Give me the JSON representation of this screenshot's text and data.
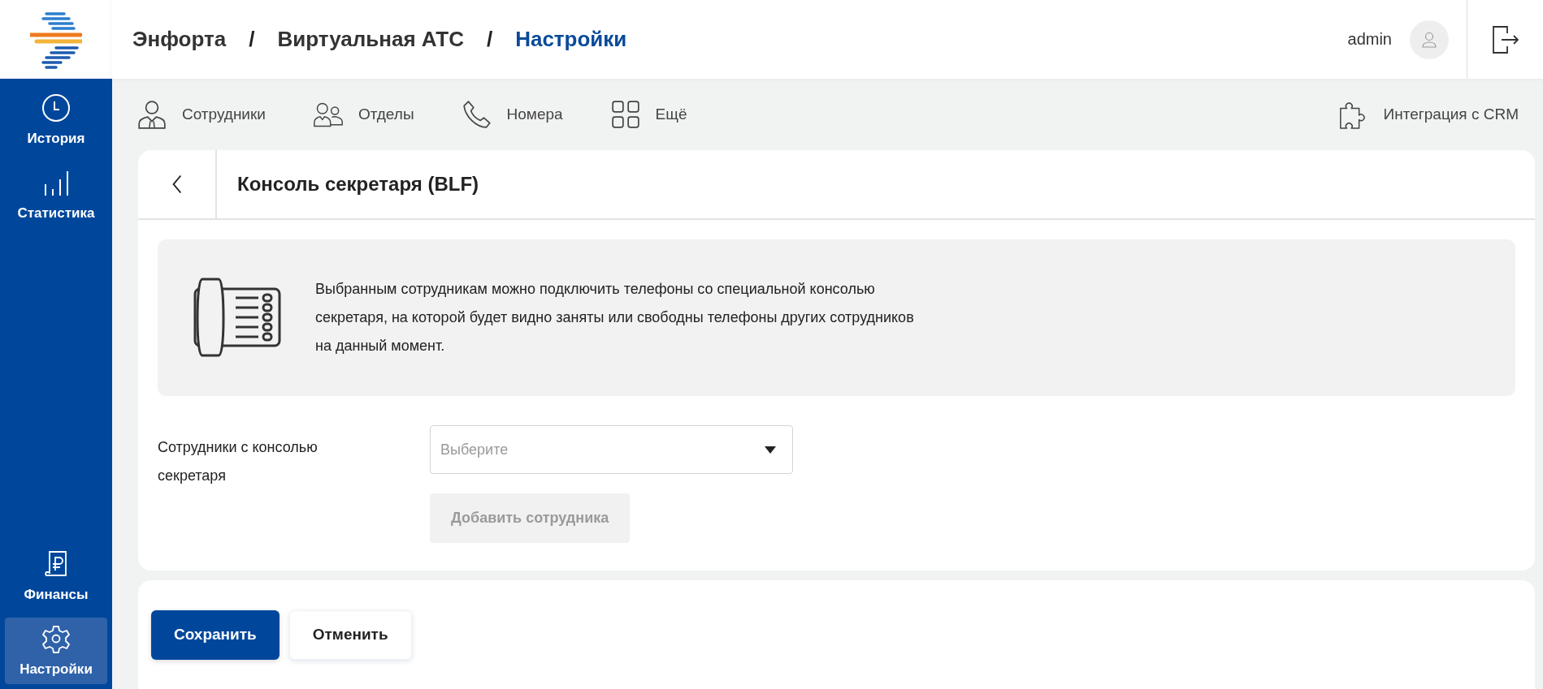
{
  "breadcrumbs": [
    {
      "label": "Энфорта",
      "current": false
    },
    {
      "label": "/",
      "kind": "separator"
    },
    {
      "label": "Виртуальная АТС",
      "current": false
    },
    {
      "label": "/",
      "kind": "separator"
    },
    {
      "label": "Настройки",
      "current": true
    }
  ],
  "user": {
    "name": "admin"
  },
  "sidebar": {
    "items": [
      {
        "label": "История",
        "kind": "clock",
        "selected": false
      },
      {
        "label": "Статистика",
        "kind": "bars",
        "selected": false
      },
      {
        "label": "Финансы",
        "kind": "ruble",
        "selected": false
      },
      {
        "label": "Настройки",
        "kind": "gear",
        "selected": true
      }
    ]
  },
  "nav": {
    "items": [
      {
        "label": "Сотрудники",
        "kind": "person"
      },
      {
        "label": "Отделы",
        "kind": "people"
      },
      {
        "label": "Номера",
        "kind": "phone"
      },
      {
        "label": "Ещё",
        "kind": "grid"
      }
    ],
    "crm": {
      "label": "Интеграция с CRM"
    }
  },
  "page": {
    "title": "Консоль секретаря (BLF)",
    "info": "Выбранным сотрудникам можно подключить телефоны со специальной консолью секретаря, на которой будет видно заняты или свободны телефоны других сотрудников на данный момент.",
    "field": {
      "label": "Сотрудники с консолью секретаря",
      "placeholder": "Выберите"
    },
    "add_button": {
      "label": "Добавить сотрудника",
      "disabled": true
    }
  },
  "buttons": [
    {
      "label": "Сохранить",
      "kind": "primary"
    },
    {
      "label": "Отменить",
      "kind": "secondary"
    }
  ]
}
